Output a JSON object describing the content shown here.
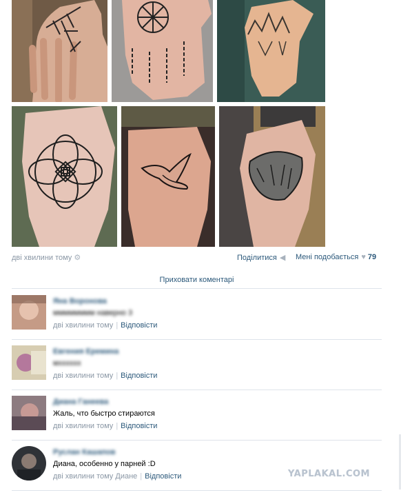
{
  "post": {
    "time": "дві хвилини тому",
    "share_label": "Поділитися",
    "like_label": "Мені подобається",
    "like_count": "79",
    "gear_icon": "gear-icon",
    "megaphone_icon": "megaphone-icon",
    "heart_icon": "heart-icon"
  },
  "comments_toggle": "Приховати коментарі",
  "comments": [
    {
      "name": "Яна Воронова",
      "text": "мммммммм навернo 3",
      "time": "дві хвилини тому",
      "reply_to": "",
      "reply": "Відповісти"
    },
    {
      "name": "Евгения Еремина",
      "text": "мхххххх",
      "time": "дві хвилини тому",
      "reply_to": "",
      "reply": "Відповісти"
    },
    {
      "name": "Диана Ганеева",
      "text": "Жаль, что быстро стираются",
      "time": "дві хвилини тому",
      "reply_to": "",
      "reply": "Відповісти"
    },
    {
      "name": "Руслан Кашапов",
      "text": "Диана, особенно у парней :D",
      "time": "дві хвилини тому",
      "reply_to": "Диане",
      "reply": "Відповісти"
    }
  ],
  "watermark": "YAPLAKAL.COM",
  "colors": {
    "link": "#2b587a",
    "muted": "#8a97a5",
    "separator": "#dee3ea"
  }
}
